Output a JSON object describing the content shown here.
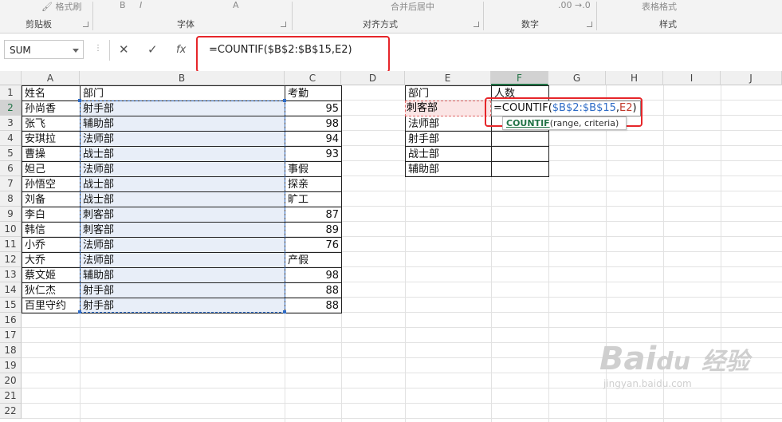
{
  "ribbon": {
    "format_painter": "格式刷",
    "groups": [
      "剪贴板",
      "字体",
      "对齐方式",
      "数字",
      "样式"
    ],
    "top_partial": {
      "merge_center": "合并后居中",
      "table_format": "表格格式",
      "decimals": ".00 →.0"
    }
  },
  "formula_bar": {
    "name_box": "SUM",
    "cancel_icon": "✕",
    "enter_icon": "✓",
    "fx_label": "fx",
    "formula": "=COUNTIF($B$2:$B$15,E2)"
  },
  "columns": [
    "A",
    "B",
    "C",
    "D",
    "E",
    "F",
    "G",
    "H",
    "I",
    "J"
  ],
  "rows": [
    "1",
    "2",
    "3",
    "4",
    "5",
    "6",
    "7",
    "8",
    "9",
    "10",
    "11",
    "12",
    "13",
    "14",
    "15",
    "16",
    "17",
    "18",
    "19",
    "20",
    "21",
    "22"
  ],
  "table1": {
    "headers": [
      "姓名",
      "部门",
      "考勤"
    ],
    "rows": [
      [
        "孙尚香",
        "射手部",
        "95"
      ],
      [
        "张飞",
        "辅助部",
        "98"
      ],
      [
        "安琪拉",
        "法师部",
        "94"
      ],
      [
        "曹操",
        "战士部",
        "93"
      ],
      [
        "妲己",
        "法师部",
        "事假"
      ],
      [
        "孙悟空",
        "战士部",
        "探亲"
      ],
      [
        "刘备",
        "战士部",
        "旷工"
      ],
      [
        "李白",
        "刺客部",
        "87"
      ],
      [
        "韩信",
        "刺客部",
        "89"
      ],
      [
        "小乔",
        "法师部",
        "76"
      ],
      [
        "大乔",
        "法师部",
        "产假"
      ],
      [
        "蔡文姬",
        "辅助部",
        "98"
      ],
      [
        "狄仁杰",
        "射手部",
        "88"
      ],
      [
        "百里守约",
        "射手部",
        "88"
      ]
    ]
  },
  "table2": {
    "headers": [
      "部门",
      "人数"
    ],
    "depts": [
      "刺客部",
      "法师部",
      "射手部",
      "战士部",
      "辅助部"
    ]
  },
  "editing": {
    "prefix": "=COUNTIF(",
    "range_ref": "$B$2:$B$15",
    "comma": ",",
    "cell_ref": "E2",
    "suffix": ")",
    "tooltip_fn": "COUNTIF",
    "tooltip_args": "(range, criteria)"
  },
  "watermark": {
    "brand": "Bai",
    "brand2": "经验",
    "url": "jingyan.baidu.com"
  },
  "colors": {
    "accent": "#217346",
    "range_blue": "#2e6bc6",
    "highlight_red": "#e6262a"
  }
}
